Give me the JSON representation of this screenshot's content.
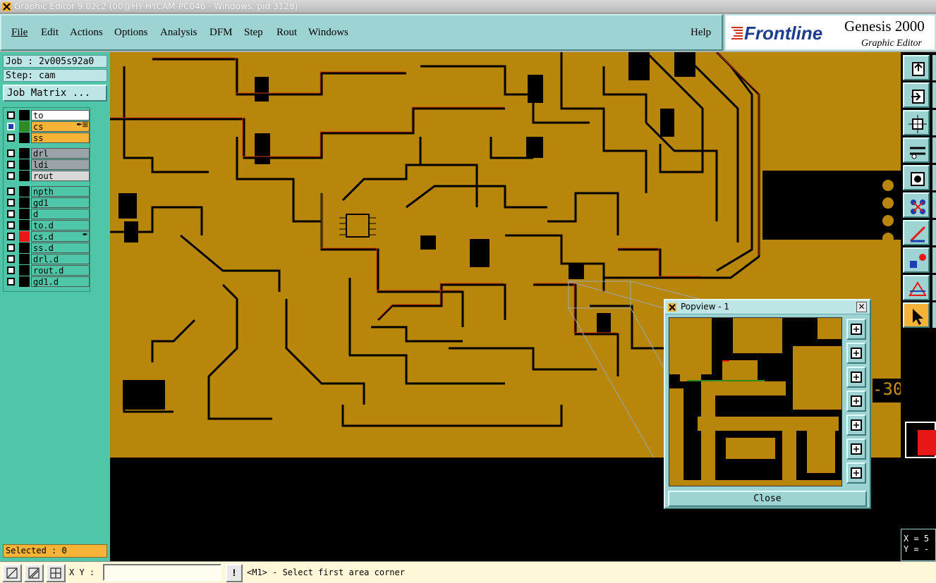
{
  "window": {
    "title": "Graphic Editor 9.02c2 (00@HY-HYCAM-PC046 - Windows, pid:3128)"
  },
  "menubar": {
    "items": [
      "File",
      "Edit",
      "Actions",
      "Options",
      "Analysis",
      "DFM",
      "Step",
      "Rout",
      "Windows"
    ],
    "help": "Help"
  },
  "brand": {
    "logo_text": "Frontline",
    "product": "Genesis 2000",
    "subtitle": "Graphic Editor"
  },
  "job": {
    "job_label": "Job : 2v005s92a0",
    "step_label": "Step: cam",
    "job_matrix": "Job Matrix ..."
  },
  "layers": [
    {
      "name": "to",
      "swatch": "#000000",
      "bg": "#ffffff",
      "active": false
    },
    {
      "name": "cs",
      "swatch": "#2e8b22",
      "bg": "#f5b338",
      "active": true,
      "mark": "✒⊞"
    },
    {
      "name": "ss",
      "swatch": "#000000",
      "bg": "#f5b338",
      "active": false
    },
    {
      "name": "drl",
      "swatch": "#000000",
      "bg": "#9aa3a8",
      "active": false
    },
    {
      "name": "ldi",
      "swatch": "#000000",
      "bg": "#9aa3a8",
      "active": false
    },
    {
      "name": "rout",
      "swatch": "#000000",
      "bg": "#d8d8d8",
      "active": false
    },
    {
      "name": "npth",
      "swatch": "#000000",
      "bg": "#4fc6a7",
      "active": false
    },
    {
      "name": "gd1",
      "swatch": "#000000",
      "bg": "#4fc6a7",
      "active": false
    },
    {
      "name": "d",
      "swatch": "#000000",
      "bg": "#4fc6a7",
      "active": false
    },
    {
      "name": "to.d",
      "swatch": "#000000",
      "bg": "#4fc6a7",
      "active": false
    },
    {
      "name": "cs.d",
      "swatch": "#e81818",
      "bg": "#4fc6a7",
      "active": false,
      "mark": "✒"
    },
    {
      "name": "ss.d",
      "swatch": "#000000",
      "bg": "#4fc6a7",
      "active": false
    },
    {
      "name": "drl.d",
      "swatch": "#000000",
      "bg": "#4fc6a7",
      "active": false
    },
    {
      "name": "rout.d",
      "swatch": "#000000",
      "bg": "#4fc6a7",
      "active": false
    },
    {
      "name": "gd1.d",
      "swatch": "#000000",
      "bg": "#4fc6a7",
      "active": false
    }
  ],
  "selected": "Selected : 0",
  "bottom": {
    "xy_label": "X Y :",
    "xy_value": "",
    "bang": "!",
    "status": "<M1> - Select first area corner"
  },
  "coords": {
    "x": "X = 5",
    "y": "Y = -"
  },
  "canvas_marker": "-30",
  "popview": {
    "title": "Popview - 1",
    "close": "Close",
    "close_x": "✕"
  },
  "colors": {
    "copper": "#b8860b",
    "trace_edge": "#d73a0a",
    "bg": "#000000",
    "panel": "#4fc6a7",
    "menu": "#9dd3d3",
    "highlight": "#f5b338"
  },
  "toolbar_icons": [
    "fit-icon",
    "zoom-home-icon",
    "zoom-fit-icon",
    "tools-icon",
    "feature-icon",
    "net-icon",
    "measure-icon",
    "select-icon",
    "drc-icon",
    "pointer-icon"
  ]
}
